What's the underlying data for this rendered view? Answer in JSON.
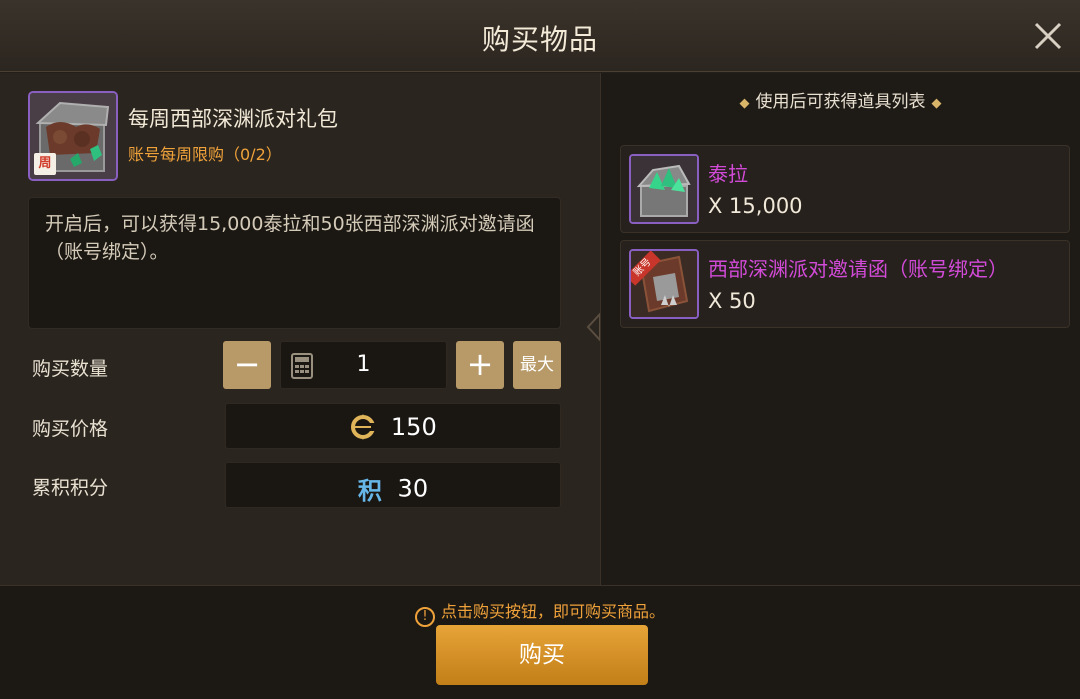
{
  "dialog": {
    "title": "购买物品",
    "close_icon": "close-icon"
  },
  "item": {
    "name": "每周西部深渊派对礼包",
    "limit": "账号每周限购（0/2）",
    "badge": "周",
    "description": "开启后，可以获得15,000泰拉和50张西部深渊派对邀请函（账号绑定）。"
  },
  "purchase": {
    "quantity_label": "购买数量",
    "minus_label": "−",
    "plus_label": "+",
    "max_label": "最大",
    "quantity": "1",
    "price_label": "购买价格",
    "price": "150",
    "points_label": "累积积分",
    "points_icon": "积",
    "points": "30"
  },
  "rewards": {
    "title": "使用后可获得道具列表",
    "items": [
      {
        "name": "泰拉",
        "qty": "X 15,000"
      },
      {
        "name": "西部深渊派对邀请函（账号绑定）",
        "qty": "X 50",
        "badge": "账号"
      }
    ]
  },
  "footer": {
    "notice": "点击购买按钮，即可购买商品。",
    "buy_label": "购买"
  },
  "colors": {
    "accent": "#f0a23a",
    "buy": "#d9921f",
    "rare": "#8a5fc2",
    "reward_name": "#d24ad8"
  }
}
